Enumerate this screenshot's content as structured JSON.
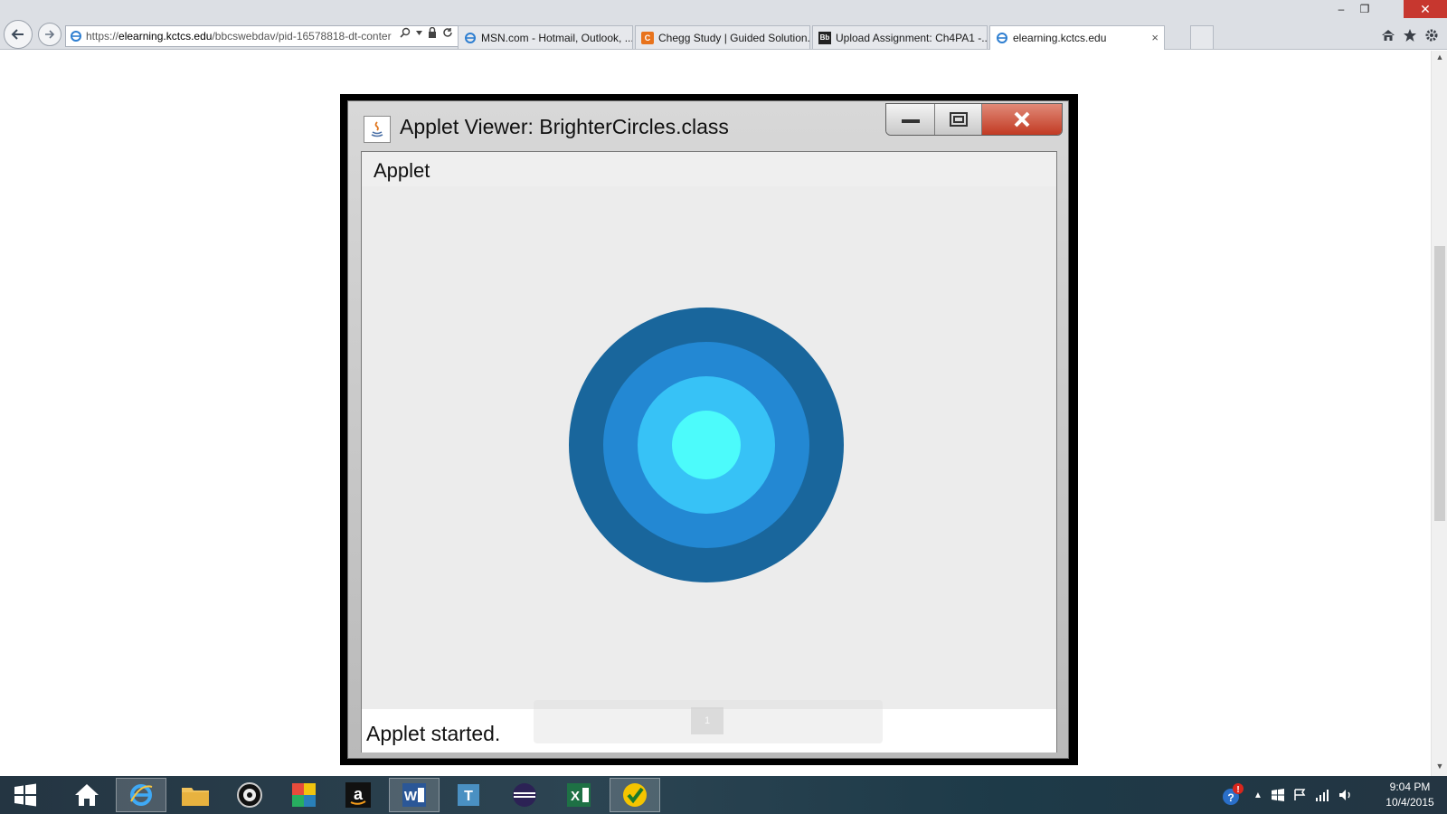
{
  "browser": {
    "address_scheme": "https://",
    "address_host": "elearning.kctcs.edu",
    "address_path": "/bbcswebdav/pid-16578818-dt-conter",
    "tabs": [
      {
        "label": "MSN.com - Hotmail, Outlook, ...",
        "icon": "ie-icon",
        "active": false
      },
      {
        "label": "Chegg Study | Guided Solution...",
        "icon": "chegg-icon",
        "active": false
      },
      {
        "label": "Upload Assignment: Ch4PA1 -...",
        "icon": "blackboard-icon",
        "active": false
      },
      {
        "label": "elearning.kctcs.edu",
        "icon": "ie-icon",
        "active": true
      }
    ],
    "tab_close_glyph": "×"
  },
  "applet_window": {
    "title": "Applet Viewer: BrighterCircles.class",
    "menu": [
      "Applet"
    ],
    "status": "Applet started.",
    "pager_current": "1"
  },
  "circles": {
    "colors": [
      "#19669c",
      "#2388d3",
      "#37c2f6",
      "#4cfbfb"
    ],
    "description_note": ""
  },
  "taskbar": {
    "items": [
      "start-icon",
      "home-icon",
      "internet-explorer-icon",
      "file-explorer-icon",
      "webcam-icon",
      "color-app-icon",
      "amazon-icon",
      "word-icon",
      "typing-app-icon",
      "eclipse-icon",
      "excel-icon",
      "norton-icon"
    ]
  },
  "clock": {
    "time": "9:04 PM",
    "date": "10/4/2015"
  }
}
